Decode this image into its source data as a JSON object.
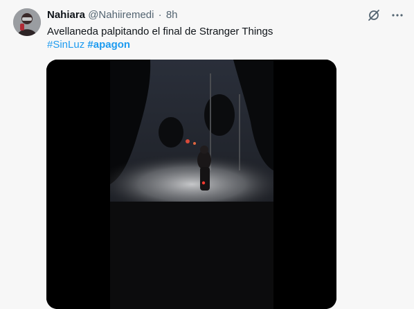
{
  "tweet": {
    "author_name": "Nahiara",
    "author_handle": "@Nahiiremedi",
    "separator": "·",
    "time": "8h",
    "text": "Avellaneda palpitando el final de Stranger Things",
    "hashtags": [
      "#SinLuz",
      "#apagon"
    ]
  },
  "icons": {
    "grok": "grok-icon",
    "more": "more-icon"
  },
  "colors": {
    "accent": "#1d9bf0",
    "secondary_text": "#536471",
    "primary_text": "#0f1419",
    "background": "#f7f7f7"
  }
}
